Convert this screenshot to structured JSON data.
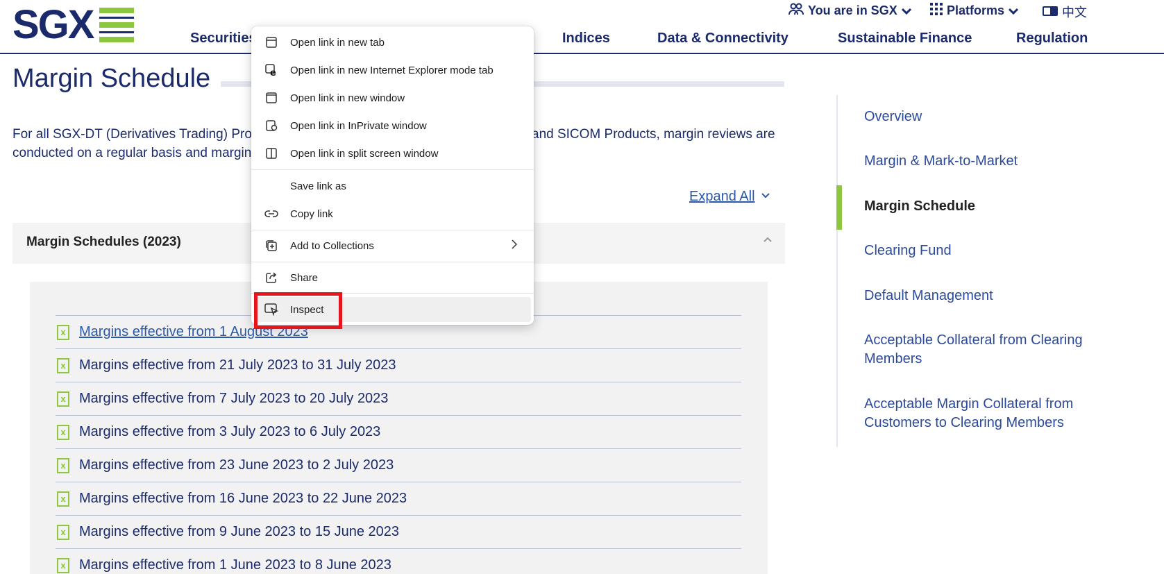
{
  "header": {
    "logo_text": "SGX",
    "utility": {
      "you_are_in": "You are in SGX",
      "platforms": "Platforms",
      "language": "中文"
    },
    "nav": [
      "Securities",
      "Indices",
      "Data & Connectivity",
      "Sustainable Finance",
      "Regulation"
    ]
  },
  "main": {
    "title": "Margin Schedule",
    "intro_line1_left": "For all SGX-DT (Derivatives Trading) Pro",
    "intro_line1_right": "and SICOM Products, margin reviews are",
    "intro_line2_left": "conducted on a regular basis and margin",
    "expand_all": "Expand All",
    "accordion_title": "Margin Schedules (2023)",
    "documents": [
      "Margins effective from 1 August 2023",
      "Margins effective from 21 July 2023 to 31 July 2023",
      "Margins effective from 7 July 2023 to 20 July 2023",
      "Margins effective from 3 July 2023 to 6 July 2023",
      "Margins effective from 23 June 2023 to 2 July 2023",
      "Margins effective from 16 June 2023 to 22 June 2023",
      "Margins effective from 9 June 2023 to 15 June 2023",
      "Margins effective from 1 June 2023 to 8 June 2023"
    ]
  },
  "sidenav": {
    "items": [
      {
        "label": "Overview"
      },
      {
        "label": "Margin & Mark-to-Market"
      },
      {
        "label": "Margin Schedule",
        "active": true
      },
      {
        "label": "Clearing Fund"
      },
      {
        "label": "Default Management"
      },
      {
        "label": "Acceptable Collateral from Clearing Members"
      },
      {
        "label": "Acceptable Margin Collateral from Customers to Clearing Members"
      }
    ]
  },
  "context_menu": {
    "items": [
      {
        "label": "Open link in new tab",
        "icon": "new-tab-icon"
      },
      {
        "label": "Open link in new Internet Explorer mode tab",
        "icon": "ie-icon"
      },
      {
        "label": "Open link in new window",
        "icon": "window-icon"
      },
      {
        "label": "Open link in InPrivate window",
        "icon": "inprivate-icon"
      },
      {
        "label": "Open link in split screen window",
        "icon": "split-screen-icon"
      },
      {
        "label": "Save link as",
        "icon": ""
      },
      {
        "label": "Copy link",
        "icon": "link-icon"
      },
      {
        "label": "Add to Collections",
        "icon": "collections-icon"
      },
      {
        "label": "Share",
        "icon": "share-icon"
      },
      {
        "label": "Inspect",
        "icon": "inspect-icon"
      }
    ]
  },
  "colors": {
    "brand_navy": "#1b2a6b",
    "brand_green": "#8dc63f",
    "link_blue": "#2b58a8",
    "highlight_red": "#e8141c"
  }
}
